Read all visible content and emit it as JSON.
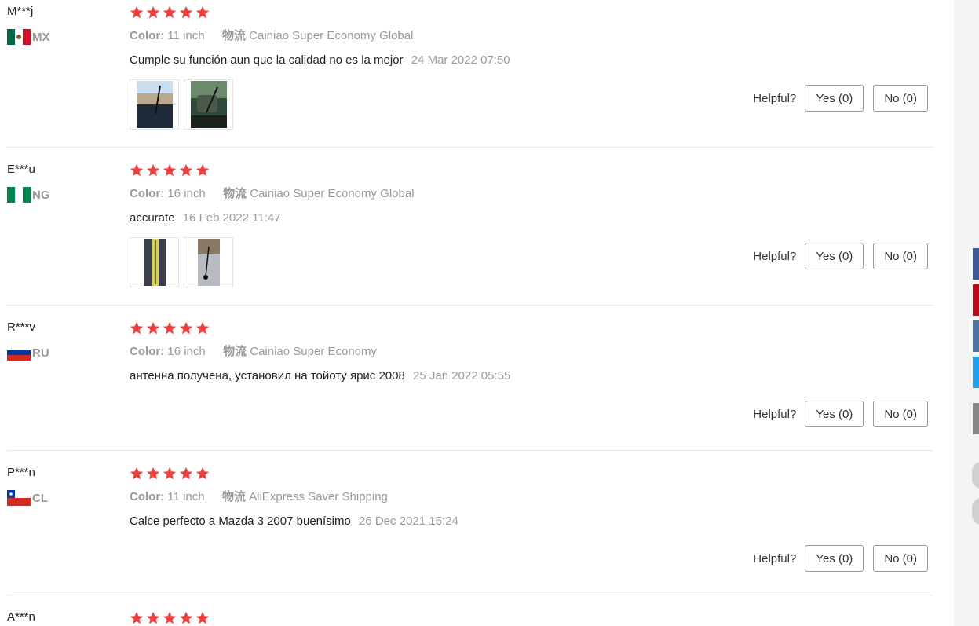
{
  "labels": {
    "color_key": "Color:",
    "shipping_key": "物流",
    "helpful": "Helpful?"
  },
  "star_color": "#f23d3d",
  "reviews": [
    {
      "user": "M***j",
      "country": "MX",
      "rating": 5,
      "color": "11 inch",
      "shipping": "Cainiao Super Economy Global",
      "text": "Cumple su función aun que la calidad no es la mejor",
      "date": "24 Mar 2022 07:50",
      "photos": [
        "photo-antenna-dashboard",
        "photo-antenna-mirror"
      ],
      "yes": "Yes (0)",
      "no": "No (0)"
    },
    {
      "user": "E***u",
      "country": "NG",
      "rating": 5,
      "color": "16 inch",
      "shipping": "Cainiao Super Economy Global",
      "text": "accurate",
      "date": "16 Feb 2022 11:47",
      "photos": [
        "photo-antenna-tape",
        "photo-antenna-roof"
      ],
      "yes": "Yes (0)",
      "no": "No (0)"
    },
    {
      "user": "R***v",
      "country": "RU",
      "rating": 5,
      "color": "16 inch",
      "shipping": "Cainiao Super Economy",
      "text": "антенна получена, установил на тойоту ярис 2008",
      "date": "25 Jan 2022 05:55",
      "photos": [],
      "yes": "Yes (0)",
      "no": "No (0)"
    },
    {
      "user": "P***n",
      "country": "CL",
      "rating": 5,
      "color": "11 inch",
      "shipping": "AliExpress Saver Shipping",
      "text": "Calce perfecto a Mazda 3 2007 buenísimo",
      "date": "26 Dec 2021 15:24",
      "photos": [],
      "yes": "Yes (0)",
      "no": "No (0)"
    },
    {
      "user": "A***n",
      "country": "",
      "rating": 5
    }
  ],
  "share_colors": [
    "#3b5998",
    "#bd081c",
    "#4c75a3",
    "#1da1f2",
    "#888888"
  ]
}
